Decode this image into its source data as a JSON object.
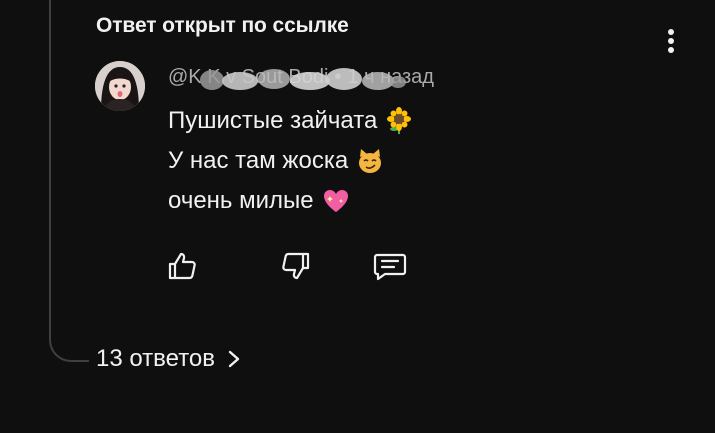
{
  "header": {
    "title": "Ответ открыт по ссылке"
  },
  "comment": {
    "author": "@K  K     v    Sout     Bodi",
    "time_separator": "•",
    "time": "1 ч назад",
    "lines": [
      {
        "text": "Пушистые зайчата",
        "emoji": "🌻"
      },
      {
        "text": "У нас там жоска",
        "emoji": "😼"
      },
      {
        "text": "очень милые",
        "emoji": "💖"
      }
    ]
  },
  "actions": {
    "like_icon": "thumbs-up-icon",
    "dislike_icon": "thumbs-down-icon",
    "reply_icon": "reply-comment-icon"
  },
  "replies": {
    "label": "13 ответов"
  },
  "colors": {
    "background": "#0f0f0f",
    "text_primary": "#f1f1f1",
    "text_secondary": "#aaaaaa",
    "thread_line": "#3f3f3f"
  }
}
